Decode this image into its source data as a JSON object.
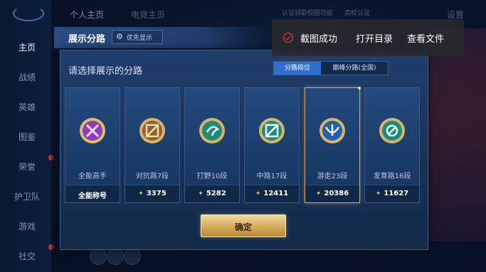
{
  "nav": {
    "items": [
      "主页",
      "战绩",
      "英雄",
      "图鉴",
      "荣誉",
      "护卫队",
      "游戏",
      "社交"
    ]
  },
  "topbar": {
    "tab_profile": "个人主页",
    "tab_esports": "电竞主页",
    "campus_banner": "认证领取校园功能",
    "campus_cert": "高校认证",
    "settings": "设置"
  },
  "dialog": {
    "title": "展示分路",
    "priority_button": "优先显示",
    "subtitle": "请选择展示的分路",
    "tabs": [
      {
        "label": "分路段位",
        "selected": true
      },
      {
        "label": "巅峰分路(全国)",
        "selected": false
      }
    ],
    "cards": [
      {
        "label": "全能高手",
        "value": "全能称号",
        "icon": "all-round-badge-icon",
        "selected": false
      },
      {
        "label": "对抗路7段",
        "value": "3375",
        "icon": "clash-lane-badge-icon",
        "selected": false
      },
      {
        "label": "打野10段",
        "value": "5282",
        "icon": "jungle-badge-icon",
        "selected": false
      },
      {
        "label": "中路17段",
        "value": "12411",
        "icon": "mid-lane-badge-icon",
        "selected": false
      },
      {
        "label": "游走23段",
        "value": "20386",
        "icon": "roam-badge-icon",
        "selected": true
      },
      {
        "label": "发育路16段",
        "value": "11627",
        "icon": "farm-lane-badge-icon",
        "selected": false
      }
    ],
    "confirm_label": "确定"
  },
  "toast": {
    "message": "截图成功",
    "open_dir": "打开目录",
    "view_file": "查看文件"
  },
  "colors": {
    "accent_blue": "#2f6fd1",
    "gold": "#d4ab5a",
    "toast_red": "#e0453f"
  }
}
